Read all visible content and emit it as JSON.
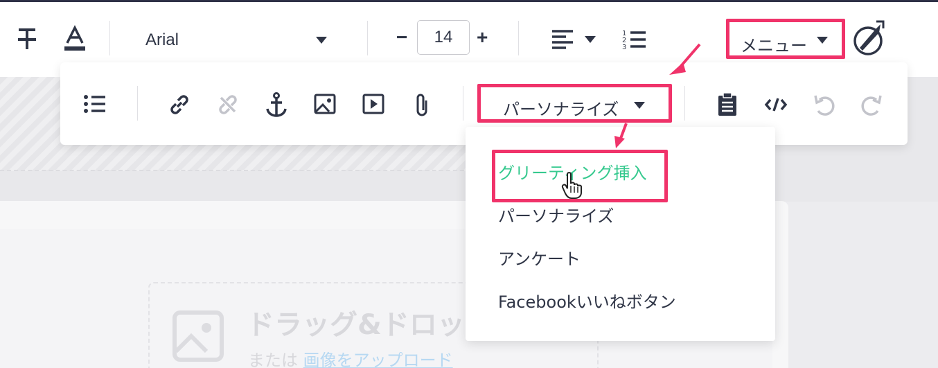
{
  "toolbar": {
    "font_family": "Arial",
    "font_size": "14",
    "decrease_label": "−",
    "increase_label": "+",
    "menu_label": "メニュー",
    "personalize_label": "パーソナライズ"
  },
  "dropdown": {
    "items": [
      {
        "label": "グリーティング挿入",
        "active": true
      },
      {
        "label": "パーソナライズ",
        "active": false
      },
      {
        "label": "アンケート",
        "active": false
      },
      {
        "label": "Facebookいいねボタン",
        "active": false
      }
    ]
  },
  "dropzone": {
    "title": "ドラッグ&ドロップ",
    "sub_prefix": "または",
    "upload_link": "画像をアップロード"
  },
  "colors": {
    "highlight": "#f0336a",
    "active_item": "#35c98e",
    "text": "#2f3546"
  }
}
